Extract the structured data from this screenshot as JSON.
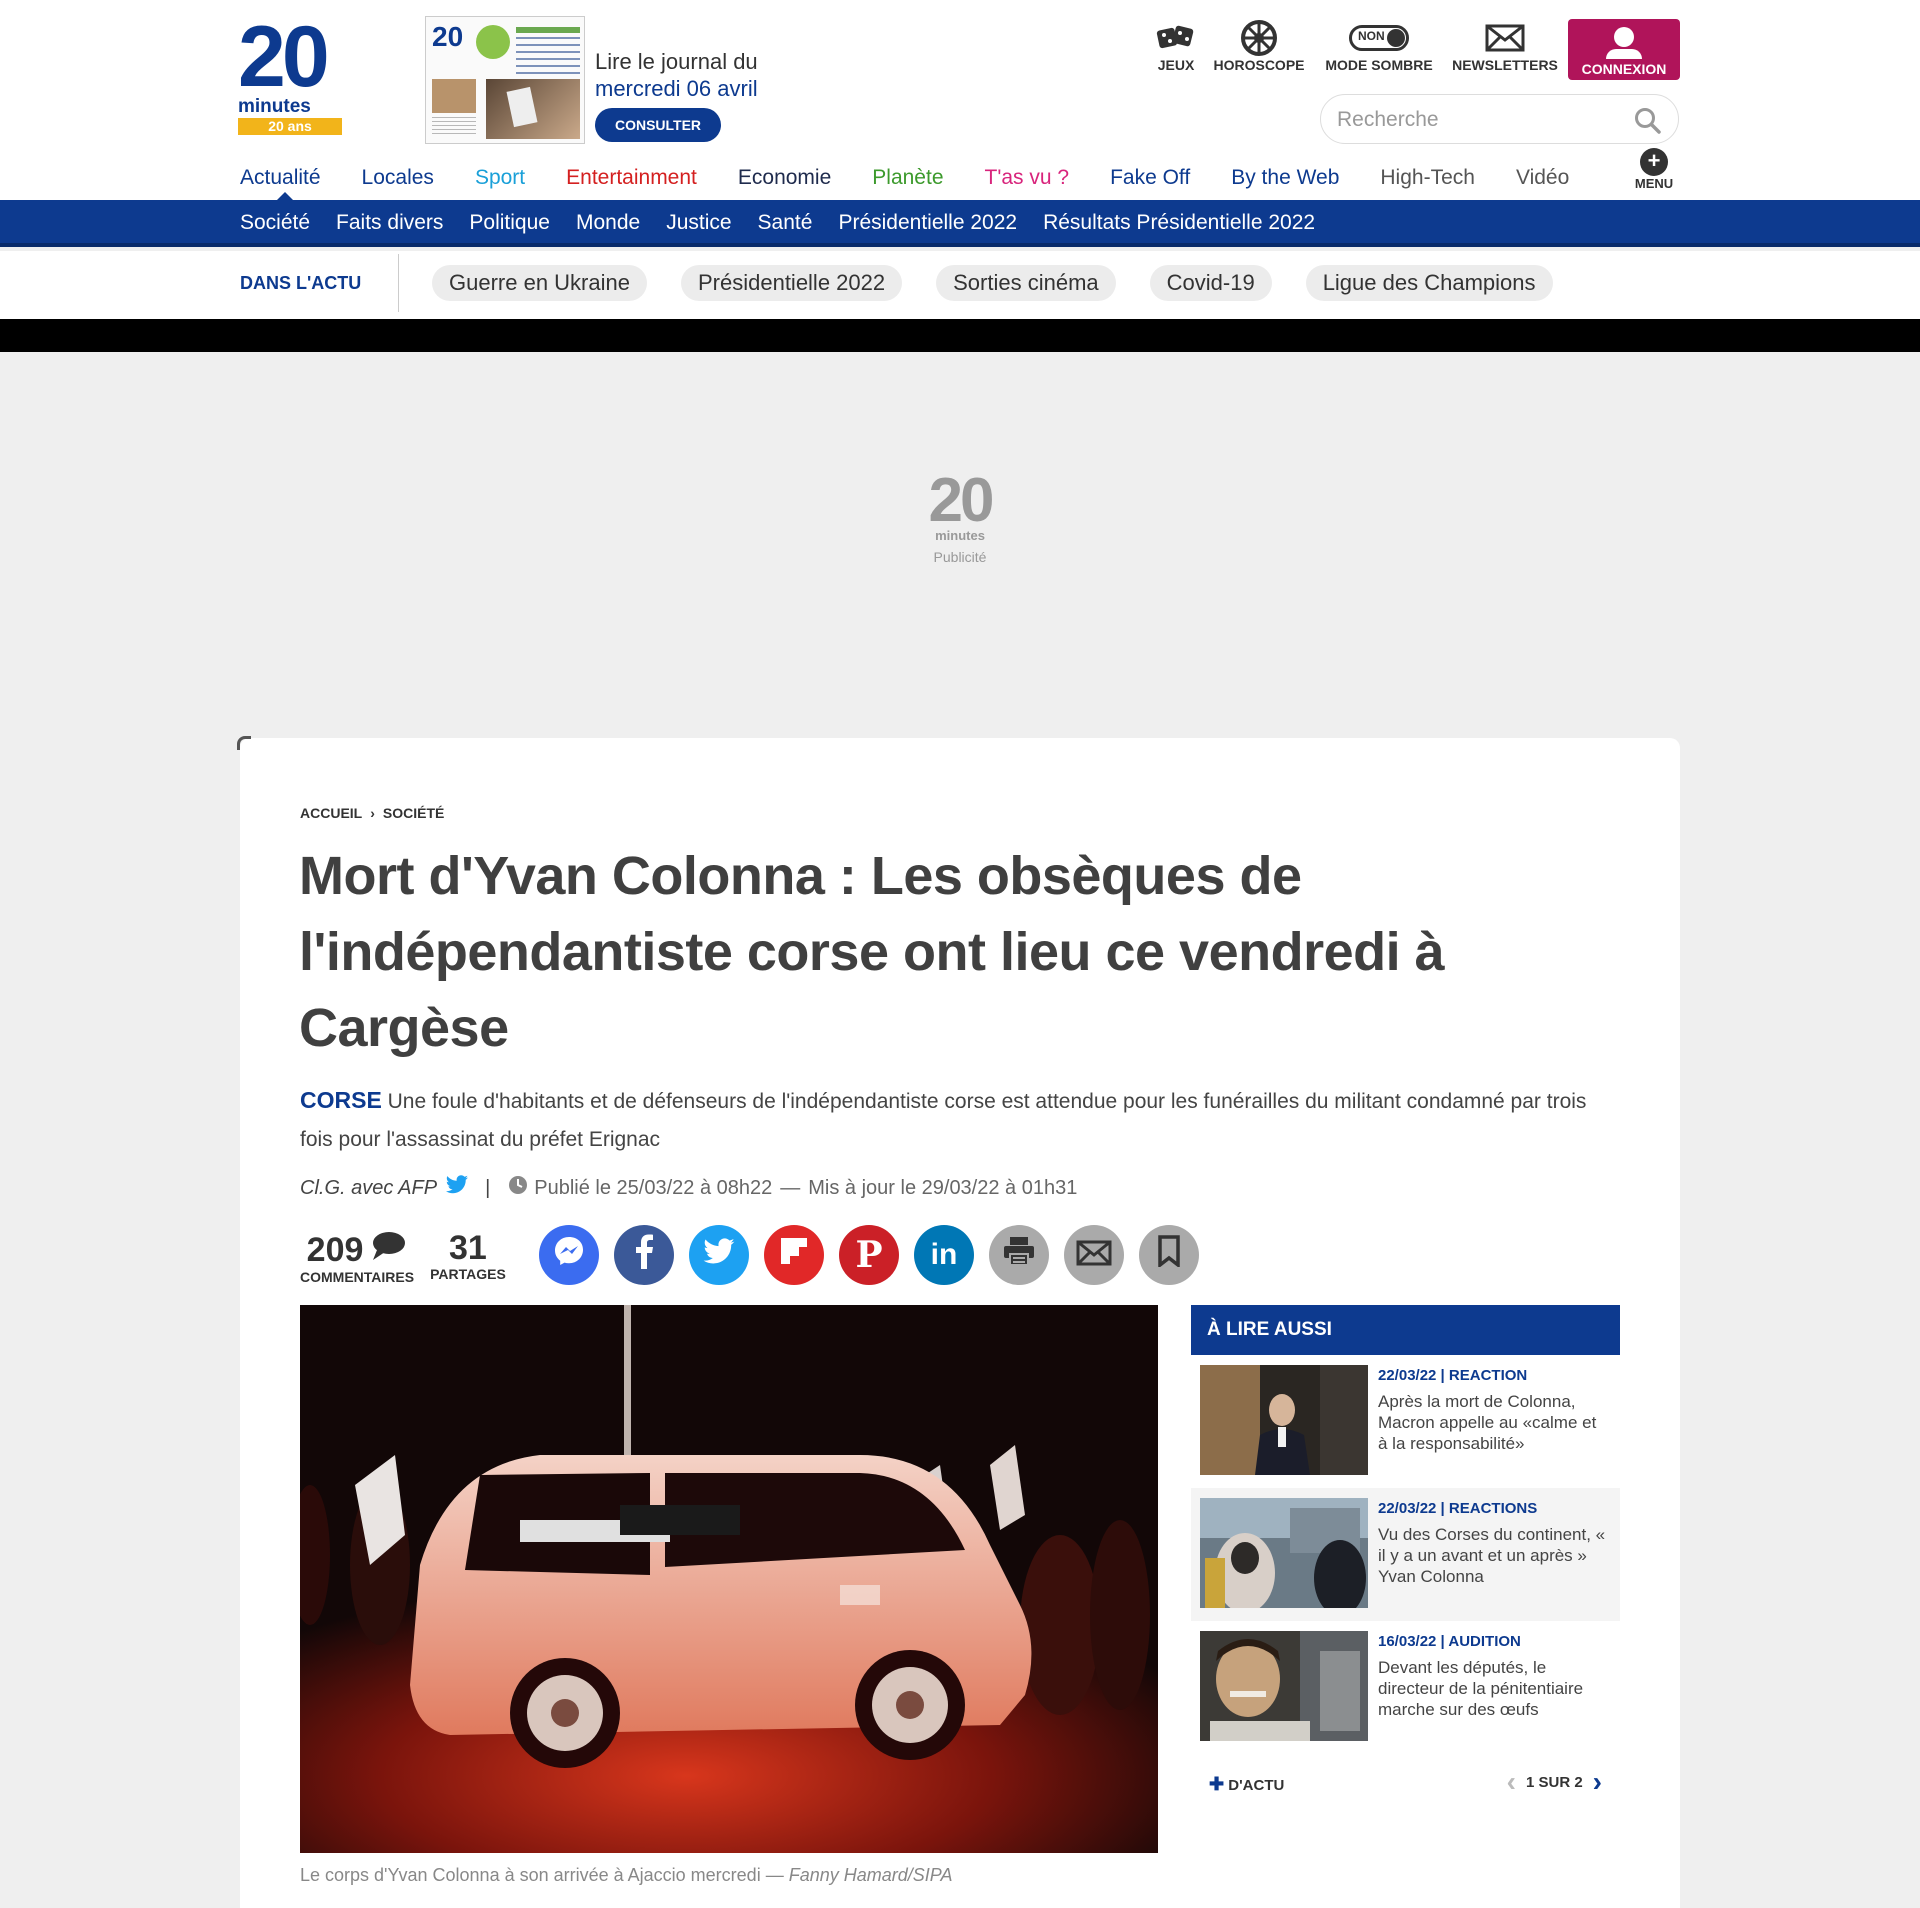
{
  "header": {
    "logo": {
      "digits": "20",
      "word": "minutes",
      "anniversary": "20 ans"
    },
    "journal": {
      "line1": "Lire le journal du",
      "date": "mercredi 06 avril",
      "button": "CONSULTER"
    },
    "tools": {
      "jeux": "JEUX",
      "horoscope": "HOROSCOPE",
      "dark_toggle": "NON",
      "mode_sombre": "MODE SOMBRE",
      "newsletters": "NEWSLETTERS",
      "connexion": "CONNEXION"
    },
    "search": {
      "placeholder": "Recherche"
    },
    "menu": "MENU"
  },
  "main_nav": [
    {
      "label": "Actualité",
      "color": "#0d3a8f"
    },
    {
      "label": "Locales",
      "color": "#0d3a8f"
    },
    {
      "label": "Sport",
      "color": "#1aa0d8"
    },
    {
      "label": "Entertainment",
      "color": "#d42020"
    },
    {
      "label": "Economie",
      "color": "#1f2b4d"
    },
    {
      "label": "Planète",
      "color": "#3c9a2c"
    },
    {
      "label": "T'as vu ?",
      "color": "#d8247c"
    },
    {
      "label": "Fake Off",
      "color": "#0d3a8f"
    },
    {
      "label": "By the Web",
      "color": "#0d3a8f"
    },
    {
      "label": "High-Tech",
      "color": "#555555"
    },
    {
      "label": "Vidéo",
      "color": "#555555"
    }
  ],
  "sub_nav": [
    "Société",
    "Faits divers",
    "Politique",
    "Monde",
    "Justice",
    "Santé",
    "Présidentielle 2022",
    "Résultats Présidentielle 2022"
  ],
  "dans_actu": {
    "label": "DANS L'ACTU",
    "pills": [
      "Guerre en Ukraine",
      "Présidentielle 2022",
      "Sorties cinéma",
      "Covid-19",
      "Ligue des Champions"
    ]
  },
  "ad": {
    "digits": "20",
    "word": "minutes",
    "label": "Publicité"
  },
  "article": {
    "breadcrumb": [
      "ACCUEIL",
      "SOCIÉTÉ"
    ],
    "title": "Mort d'Yvan Colonna : Les obsèques de l'indépendantiste corse ont lieu ce vendredi à Cargèse",
    "lead_tag": "CORSE",
    "lead": "Une foule d'habitants et de défenseurs de l'indépendantiste corse est attendue pour les funérailles du militant condamné par trois fois pour l'assassinat du préfet Erignac",
    "author": "Cl.G. avec AFP",
    "published": "Publié le 25/03/22 à 08h22",
    "updated": "Mis à jour le 29/03/22 à 01h31",
    "comments_count": "209",
    "comments_label": "COMMENTAIRES",
    "shares_count": "31",
    "shares_label": "PARTAGES",
    "caption": "Le corps d'Yvan Colonna à son arrivée à Ajaccio mercredi",
    "credit": "Fanny Hamard/SIPA"
  },
  "share_buttons": [
    {
      "name": "messenger",
      "color": "#3b6cf0"
    },
    {
      "name": "facebook",
      "color": "#3b5998"
    },
    {
      "name": "twitter",
      "color": "#1da1f2"
    },
    {
      "name": "flipboard",
      "color": "#e12828"
    },
    {
      "name": "pinterest",
      "color": "#cb2027"
    },
    {
      "name": "linkedin",
      "color": "#0077b5"
    },
    {
      "name": "print",
      "color": "#aaaaaa"
    },
    {
      "name": "email",
      "color": "#aaaaaa"
    },
    {
      "name": "bookmark",
      "color": "#aaaaaa"
    }
  ],
  "aside": {
    "title": "À LIRE AUSSI",
    "items": [
      {
        "kicker": "22/03/22 | REACTION",
        "text": "Après la mort de Colonna, Macron appelle au «calme et à la responsabilité»"
      },
      {
        "kicker": "22/03/22 | REACTIONS",
        "text": "Vu des Corses du continent, « il y a un avant et un après » Yvan Colonna"
      },
      {
        "kicker": "16/03/22 | AUDITION",
        "text": "Devant les députés, le directeur de la pénitentiaire marche sur des œufs"
      }
    ],
    "more": "D'ACTU",
    "page": "1",
    "page_sep": "SUR",
    "page_total": "2"
  }
}
